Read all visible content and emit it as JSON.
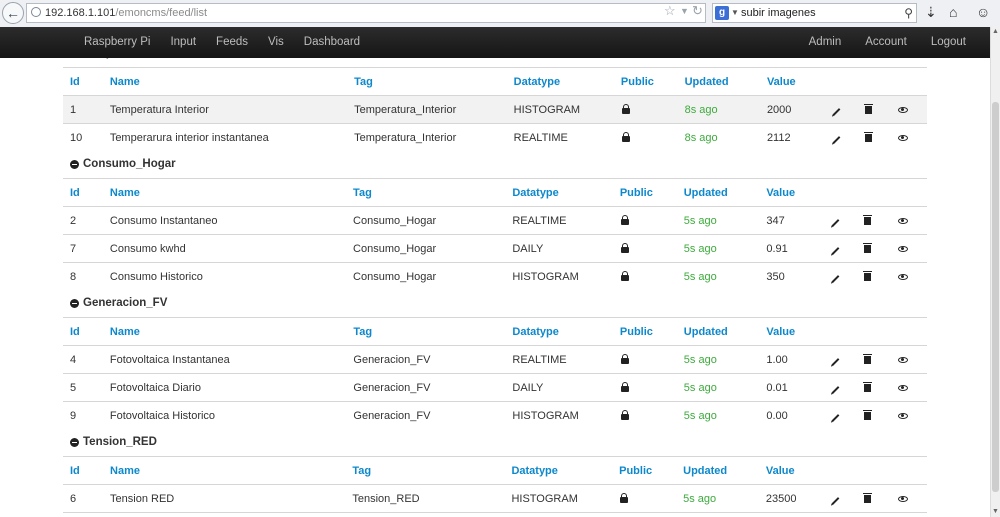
{
  "browser": {
    "url_host": "192.168.1.101",
    "url_path": "/emoncms/feed/list",
    "search_engine": "g",
    "search_text": "subir imagenes",
    "icons": [
      "back-icon",
      "globe-icon",
      "star-icon",
      "dropdown-icon",
      "reload-icon",
      "google-icon",
      "magnifier-icon",
      "download-icon",
      "home-icon",
      "feedback-icon"
    ]
  },
  "nav": {
    "left": [
      "Raspberry Pi",
      "Input",
      "Feeds",
      "Vis",
      "Dashboard"
    ],
    "right": [
      "Admin",
      "Account",
      "Logout"
    ]
  },
  "colors": {
    "header": "#0d88cc",
    "updated": "#3dab3d",
    "navbar": "#1b1b1b"
  },
  "columns": {
    "id": "Id",
    "name": "Name",
    "tag": "Tag",
    "datatype": "Datatype",
    "public": "Public",
    "updated": "Updated",
    "value": "Value"
  },
  "groups": [
    {
      "title": "Temperatura_Interior",
      "rows": [
        {
          "id": "1",
          "name": "Temperatura Interior",
          "tag": "Temperatura_Interior",
          "datatype": "HISTOGRAM",
          "updated": "8s ago",
          "value": "2000"
        },
        {
          "id": "10",
          "name": "Temperarura interior instantanea",
          "tag": "Temperatura_Interior",
          "datatype": "REALTIME",
          "updated": "8s ago",
          "value": "2112"
        }
      ]
    },
    {
      "title": "Consumo_Hogar",
      "rows": [
        {
          "id": "2",
          "name": "Consumo Instantaneo",
          "tag": "Consumo_Hogar",
          "datatype": "REALTIME",
          "updated": "5s ago",
          "value": "347"
        },
        {
          "id": "7",
          "name": "Consumo kwhd",
          "tag": "Consumo_Hogar",
          "datatype": "DAILY",
          "updated": "5s ago",
          "value": "0.91"
        },
        {
          "id": "8",
          "name": "Consumo Historico",
          "tag": "Consumo_Hogar",
          "datatype": "HISTOGRAM",
          "updated": "5s ago",
          "value": "350"
        }
      ]
    },
    {
      "title": "Generacion_FV",
      "rows": [
        {
          "id": "4",
          "name": "Fotovoltaica Instantanea",
          "tag": "Generacion_FV",
          "datatype": "REALTIME",
          "updated": "5s ago",
          "value": "1.00"
        },
        {
          "id": "5",
          "name": "Fotovoltaica Diario",
          "tag": "Generacion_FV",
          "datatype": "DAILY",
          "updated": "5s ago",
          "value": "0.01"
        },
        {
          "id": "9",
          "name": "Fotovoltaica Historico",
          "tag": "Generacion_FV",
          "datatype": "HISTOGRAM",
          "updated": "5s ago",
          "value": "0.00"
        }
      ]
    },
    {
      "title": "Tension_RED",
      "rows": [
        {
          "id": "6",
          "name": "Tension RED",
          "tag": "Tension_RED",
          "datatype": "HISTOGRAM",
          "updated": "5s ago",
          "value": "23500"
        }
      ]
    }
  ]
}
